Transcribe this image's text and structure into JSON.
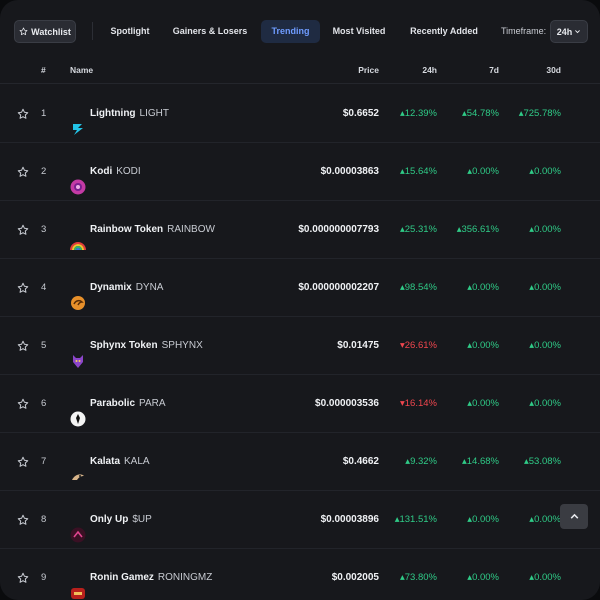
{
  "toolbar": {
    "watchlist_label": "Watchlist",
    "tabs": [
      {
        "label": "Spotlight"
      },
      {
        "label": "Gainers & Losers"
      },
      {
        "label": "Trending"
      },
      {
        "label": "Most Visited"
      },
      {
        "label": "Recently Added"
      }
    ],
    "active_tab": "Trending",
    "timeframe_label": "Timeframe:",
    "timeframe_value": "24h"
  },
  "table": {
    "headers": {
      "rank": "#",
      "name": "Name",
      "price": "Price",
      "h24": "24h",
      "d7": "7d",
      "d30": "30d"
    },
    "rows": [
      {
        "rank": "1",
        "name": "Lightning",
        "symbol": "LIGHT",
        "price": "$0.6652",
        "h24": "12.39%",
        "h24_dir": "up",
        "d7": "54.78%",
        "d7_dir": "up",
        "d30": "725.78%",
        "d30_dir": "up",
        "icon": "lightning-icon"
      },
      {
        "rank": "2",
        "name": "Kodi",
        "symbol": "KODI",
        "price": "$0.00003863",
        "h24": "15.64%",
        "h24_dir": "up",
        "d7": "0.00%",
        "d7_dir": "up",
        "d30": "0.00%",
        "d30_dir": "up",
        "icon": "kodi-icon"
      },
      {
        "rank": "3",
        "name": "Rainbow Token",
        "symbol": "RAINBOW",
        "price": "$0.000000007793",
        "h24": "25.31%",
        "h24_dir": "up",
        "d7": "356.61%",
        "d7_dir": "up",
        "d30": "0.00%",
        "d30_dir": "up",
        "icon": "rainbow-icon"
      },
      {
        "rank": "4",
        "name": "Dynamix",
        "symbol": "DYNA",
        "price": "$0.000000002207",
        "h24": "98.54%",
        "h24_dir": "up",
        "d7": "0.00%",
        "d7_dir": "up",
        "d30": "0.00%",
        "d30_dir": "up",
        "icon": "dynamix-icon"
      },
      {
        "rank": "5",
        "name": "Sphynx Token",
        "symbol": "SPHYNX",
        "price": "$0.01475",
        "h24": "26.61%",
        "h24_dir": "down",
        "d7": "0.00%",
        "d7_dir": "up",
        "d30": "0.00%",
        "d30_dir": "up",
        "icon": "sphynx-icon"
      },
      {
        "rank": "6",
        "name": "Parabolic",
        "symbol": "PARA",
        "price": "$0.000003536",
        "h24": "16.14%",
        "h24_dir": "down",
        "d7": "0.00%",
        "d7_dir": "up",
        "d30": "0.00%",
        "d30_dir": "up",
        "icon": "parabolic-icon"
      },
      {
        "rank": "7",
        "name": "Kalata",
        "symbol": "KALA",
        "price": "$0.4662",
        "h24": "9.32%",
        "h24_dir": "up",
        "d7": "14.68%",
        "d7_dir": "up",
        "d30": "53.08%",
        "d30_dir": "up",
        "icon": "kalata-icon"
      },
      {
        "rank": "8",
        "name": "Only Up",
        "symbol": "$UP",
        "price": "$0.00003896",
        "h24": "131.51%",
        "h24_dir": "up",
        "d7": "0.00%",
        "d7_dir": "up",
        "d30": "0.00%",
        "d30_dir": "up",
        "icon": "only-up-icon"
      },
      {
        "rank": "9",
        "name": "Ronin Gamez",
        "symbol": "RONINGMZ",
        "price": "$0.002005",
        "h24": "73.80%",
        "h24_dir": "up",
        "d7": "0.00%",
        "d7_dir": "up",
        "d30": "0.00%",
        "d30_dir": "up",
        "icon": "ronin-gamez-icon"
      }
    ]
  },
  "colors": {
    "up": "#2fcb87",
    "down": "#f0464e",
    "accent": "#6f9cff"
  }
}
